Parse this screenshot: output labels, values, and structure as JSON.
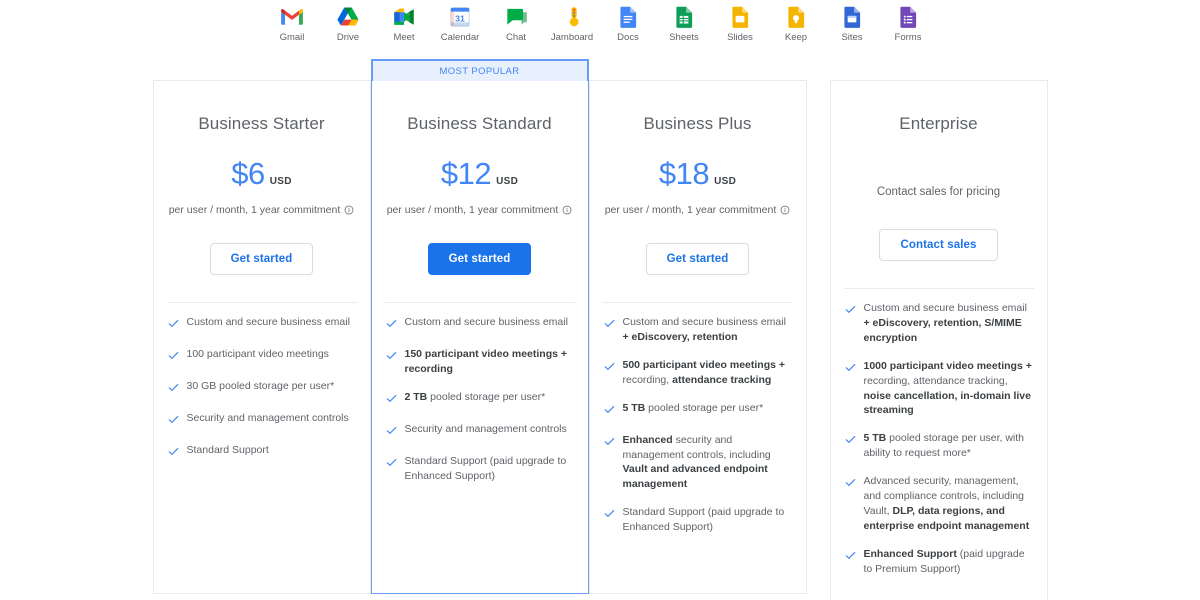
{
  "apps_bar": {
    "apps": [
      {
        "name": "Gmail",
        "icon": "gmail-icon"
      },
      {
        "name": "Drive",
        "icon": "drive-icon"
      },
      {
        "name": "Meet",
        "icon": "meet-icon"
      },
      {
        "name": "Calendar",
        "icon": "calendar-icon"
      },
      {
        "name": "Chat",
        "icon": "chat-icon"
      },
      {
        "name": "Jamboard",
        "icon": "jamboard-icon"
      },
      {
        "name": "Docs",
        "icon": "docs-icon"
      },
      {
        "name": "Sheets",
        "icon": "sheets-icon"
      },
      {
        "name": "Slides",
        "icon": "slides-icon"
      },
      {
        "name": "Keep",
        "icon": "keep-icon"
      },
      {
        "name": "Sites",
        "icon": "sites-icon"
      },
      {
        "name": "Forms",
        "icon": "forms-icon"
      }
    ]
  },
  "badge_label": "MOST POPULAR",
  "commitment_text": "per user / month, 1 year commitment",
  "colors": {
    "accent_blue": "#1a73e8",
    "price_blue": "#4285f4",
    "badge_bg": "#e8f0fe",
    "popular_border": "#669df6",
    "card_border": "#e8eaed",
    "text_gray": "#5f6368",
    "text_dark": "#3c4043"
  },
  "plans": [
    {
      "id": "business-starter",
      "title": "Business Starter",
      "price": "$6",
      "currency": "USD",
      "cta": "Get started",
      "features": [
        [
          {
            "t": "Custom and secure business email",
            "b": false
          }
        ],
        [
          {
            "t": "100 participant video meetings",
            "b": false
          }
        ],
        [
          {
            "t": "30 GB pooled storage per user*",
            "b": false
          }
        ],
        [
          {
            "t": "Security and management controls",
            "b": false
          }
        ],
        [
          {
            "t": "Standard Support",
            "b": false
          }
        ]
      ]
    },
    {
      "id": "business-standard",
      "title": "Business Standard",
      "price": "$12",
      "currency": "USD",
      "cta": "Get started",
      "features": [
        [
          {
            "t": "Custom and secure business email",
            "b": false
          }
        ],
        [
          {
            "t": "150 participant video meetings + recording",
            "b": true
          }
        ],
        [
          {
            "t": "2 TB",
            "b": true
          },
          {
            "t": " pooled storage per user*",
            "b": false
          }
        ],
        [
          {
            "t": "Security and management controls",
            "b": false
          }
        ],
        [
          {
            "t": "Standard Support (paid upgrade to Enhanced Support)",
            "b": false
          }
        ]
      ]
    },
    {
      "id": "business-plus",
      "title": "Business Plus",
      "price": "$18",
      "currency": "USD",
      "cta": "Get started",
      "features": [
        [
          {
            "t": "Custom and secure business email ",
            "b": false
          },
          {
            "t": "+ eDiscovery, retention",
            "b": true
          }
        ],
        [
          {
            "t": "500 participant video meetings + ",
            "b": true
          },
          {
            "t": "recording, ",
            "b": false
          },
          {
            "t": "attendance tracking",
            "b": true
          }
        ],
        [
          {
            "t": "5 TB",
            "b": true
          },
          {
            "t": " pooled storage per user*",
            "b": false
          }
        ],
        [
          {
            "t": "Enhanced",
            "b": true
          },
          {
            "t": " security and management controls, including ",
            "b": false
          },
          {
            "t": "Vault and advanced endpoint management",
            "b": true
          }
        ],
        [
          {
            "t": "Standard Support (paid upgrade to Enhanced Support)",
            "b": false
          }
        ]
      ]
    },
    {
      "id": "enterprise",
      "title": "Enterprise",
      "price_note": "Contact sales for pricing",
      "cta": "Contact sales",
      "features": [
        [
          {
            "t": "Custom and secure business email ",
            "b": false
          },
          {
            "t": "+ eDiscovery, retention, S/MIME encryption",
            "b": true
          }
        ],
        [
          {
            "t": "1000 participant video meetings + ",
            "b": true
          },
          {
            "t": "recording, attendance tracking, ",
            "b": false
          },
          {
            "t": "noise cancellation, in-domain live streaming",
            "b": true
          }
        ],
        [
          {
            "t": "5 TB",
            "b": true
          },
          {
            "t": " pooled storage per user, with ability to request more*",
            "b": false
          }
        ],
        [
          {
            "t": "Advanced security, management, and compliance controls, including Vault, ",
            "b": false
          },
          {
            "t": "DLP, data regions, and enterprise endpoint management",
            "b": true
          }
        ],
        [
          {
            "t": "Enhanced Support",
            "b": true
          },
          {
            "t": " (paid upgrade to Premium Support)",
            "b": false
          }
        ]
      ]
    }
  ]
}
